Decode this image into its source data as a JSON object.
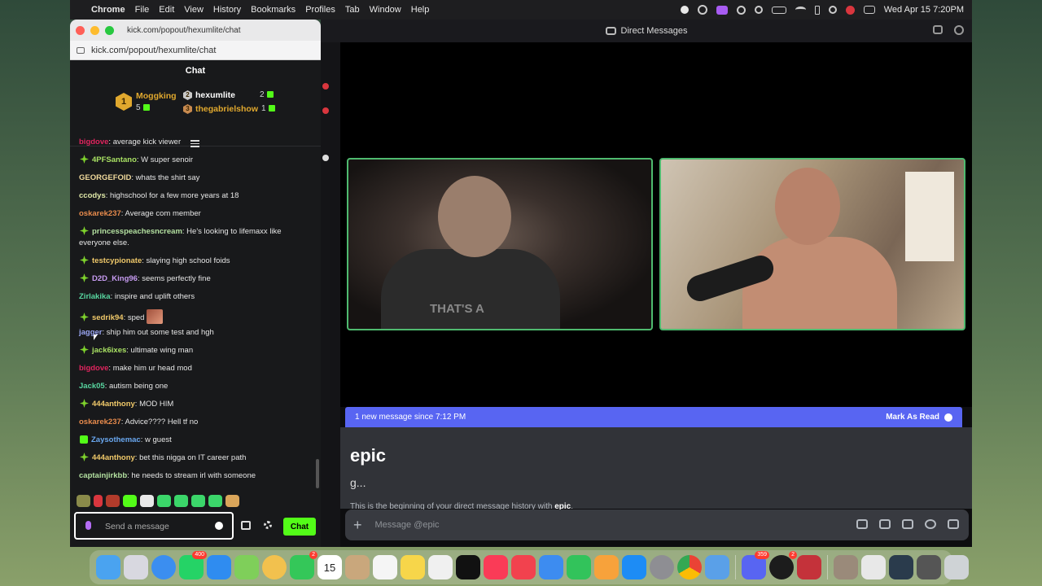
{
  "menubar": {
    "app_name": "Chrome",
    "items": [
      "File",
      "Edit",
      "View",
      "History",
      "Bookmarks",
      "Profiles",
      "Tab",
      "Window",
      "Help"
    ],
    "clock": "Wed Apr 15  7:20PM"
  },
  "kick": {
    "window_title": "kick.com/popout/hexumlite/chat",
    "url": "kick.com/popout/hexumlite/chat",
    "header": "Chat",
    "leaderboard": {
      "first": {
        "rank": "1",
        "name": "Moggking",
        "count": "5"
      },
      "second": {
        "rank": "2",
        "name": "hexumlite",
        "count": "2"
      },
      "third": {
        "rank": "3",
        "name": "thegabrielshow",
        "count": "1"
      }
    },
    "messages": [
      {
        "user": "bigdove",
        "text": ": average kick viewer",
        "color": "#e0245e",
        "badge": ""
      },
      {
        "user": "4PFSantano",
        "text": ": W super senoir",
        "color": "#a8e063",
        "badge": "star"
      },
      {
        "user": "GEORGEFOID",
        "text": ": whats the shirt say",
        "color": "#f0d99b",
        "badge": ""
      },
      {
        "user": "ccodys",
        "text": ": highschool for a few more years at 18",
        "color": "#dfe8a8",
        "badge": ""
      },
      {
        "user": "oskarek237",
        "text": ": Average com member",
        "color": "#e68a4c",
        "badge": ""
      },
      {
        "user": "princesspeachesncream",
        "text": ": He's looking to lifemaxx like everyone else.",
        "color": "#b3e0a0",
        "badge": "star"
      },
      {
        "user": "testcypionate",
        "text": ": slaying high school foids",
        "color": "#f0c96a",
        "badge": "star"
      },
      {
        "user": "D2D_King96",
        "text": ": seems perfectly fine",
        "color": "#c79cf2",
        "badge": "star"
      },
      {
        "user": "Zirlakika",
        "text": ": inspire and uplift others",
        "color": "#58d6a0",
        "badge": ""
      },
      {
        "user": "sedrik94",
        "text": ": sped",
        "color": "#f0c96a",
        "badge": "star"
      },
      {
        "user": "jagger",
        "text": ": ship him out some test and hgh",
        "color": "#9aa6f2",
        "badge": ""
      },
      {
        "user": "jack6ixes",
        "text": ": ultimate wing man",
        "color": "#a8e063",
        "badge": "star"
      },
      {
        "user": "bigdove",
        "text": ": make him ur head mod",
        "color": "#e0245e",
        "badge": ""
      },
      {
        "user": "Jack05",
        "text": ": autism being one",
        "color": "#58d6a0",
        "badge": ""
      },
      {
        "user": "444anthony",
        "text": ": MOD HIM",
        "color": "#f0c96a",
        "badge": "star"
      },
      {
        "user": "oskarek237",
        "text": ": Advice???? Hell tf no",
        "color": "#e68a4c",
        "badge": ""
      },
      {
        "user": "Zaysothemac",
        "text": ": w guest",
        "color": "#6aa8f0",
        "badge": "gift"
      },
      {
        "user": "444anthony",
        "text": ": bet this nigga on IT career path",
        "color": "#f0c96a",
        "badge": "star"
      },
      {
        "user": "captainjirkbb",
        "text": ": he needs to stream irl with someone",
        "color": "#b3e0a0",
        "badge": ""
      }
    ],
    "input_placeholder": "Send a message",
    "chat_button": "Chat"
  },
  "discord": {
    "window_title": "Direct Messages",
    "banner_text": "1 new message since 7:12 PM",
    "banner_action": "Mark As Read",
    "dm_name": "epic",
    "dm_subtitle": "g...",
    "dm_intro_prefix": "This is the beginning of your direct message history with ",
    "dm_intro_name": "epic",
    "dm_intro_suffix": ".",
    "shirt_text": "THAT'S A",
    "input_placeholder": "Message @epic"
  },
  "dock": {
    "calendar_day": "15",
    "badges": {
      "whatsapp": "400",
      "facetime": "2",
      "discord": "359",
      "spotify": "2"
    }
  }
}
